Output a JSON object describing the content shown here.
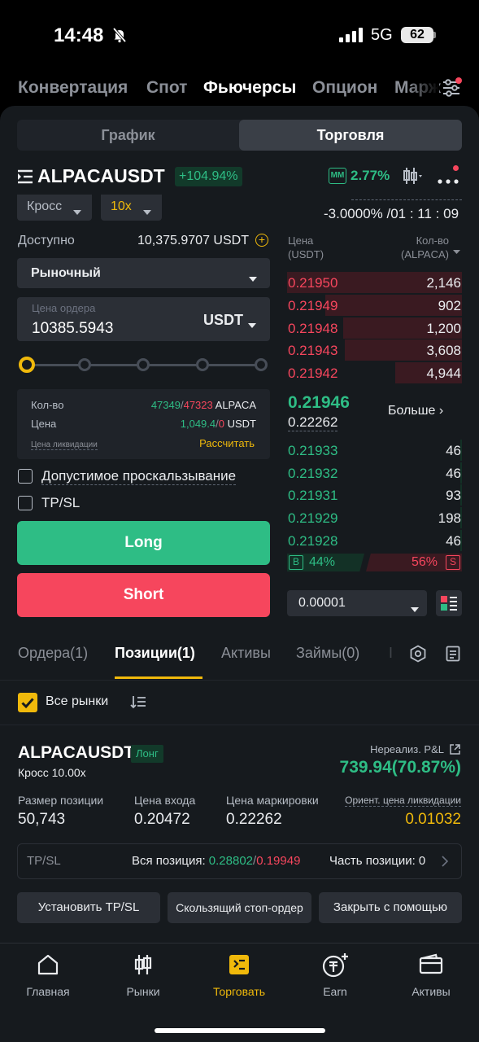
{
  "status_bar": {
    "time": "14:48",
    "network": "5G",
    "battery": "62"
  },
  "top_tabs": [
    "Конвертация",
    "Спот",
    "Фьючерсы",
    "Опцион",
    "Марж"
  ],
  "segments": {
    "chart": "График",
    "trade": "Торговля"
  },
  "pair": {
    "name": "ALPACAUSDT",
    "change": "+104.94%",
    "mm_badge": "MM",
    "mm_value": "2.77%"
  },
  "margin": {
    "mode": "Кросс",
    "leverage": "10x"
  },
  "funding": {
    "rate_countdown": "-3.0000% /01 : 11 : 09"
  },
  "order_form": {
    "available_label": "Доступно",
    "available_value": "10,375.9707 USDT",
    "order_type": "Рыночный",
    "price_placeholder": "Цена ордера",
    "price_value": "10385.5943",
    "price_unit": "USDT",
    "slider_percent": 0,
    "info": {
      "qty_label": "Кол-во",
      "qty_long": "47349",
      "qty_sep": "/",
      "qty_short": "47323",
      "qty_unit": "ALPACA",
      "price_label": "Цена",
      "price_long": "1,049.4",
      "price_short": "0",
      "price_unit": "USDT",
      "liq_label": "Цена ликвидации",
      "liq_action": "Рассчитать"
    },
    "slippage_label": "Допустимое проскальзывание",
    "tpsl_label": "TP/SL",
    "long_label": "Long",
    "short_label": "Short"
  },
  "order_book": {
    "price_head_1": "Цена",
    "price_head_2": "(USDT)",
    "qty_head_1": "Кол-во",
    "qty_head_2": "(ALPACA)",
    "asks": [
      {
        "price": "0.21950",
        "qty": "2,146",
        "depth": 1.0
      },
      {
        "price": "0.21949",
        "qty": "902",
        "depth": 0.78
      },
      {
        "price": "0.21948",
        "qty": "1,200",
        "depth": 0.68
      },
      {
        "price": "0.21943",
        "qty": "3,608",
        "depth": 0.67
      },
      {
        "price": "0.21942",
        "qty": "4,944",
        "depth": 0.38
      }
    ],
    "last_price": "0.21946",
    "mark_price": "0.22262",
    "more_label": "Больше ›",
    "bids": [
      {
        "price": "0.21933",
        "qty": "46",
        "depth": 0.01
      },
      {
        "price": "0.21932",
        "qty": "46",
        "depth": 0.01
      },
      {
        "price": "0.21931",
        "qty": "93",
        "depth": 0.01
      },
      {
        "price": "0.21929",
        "qty": "198",
        "depth": 0.01
      },
      {
        "price": "0.21928",
        "qty": "46",
        "depth": 0.01
      }
    ],
    "buy_badge": "B",
    "buy_ratio": "44%",
    "sell_ratio": "56%",
    "sell_badge": "S",
    "precision": "0.00001"
  },
  "sub_tabs": [
    "Ордера(1)",
    "Позиции(1)",
    "Активы",
    "Займы(0)",
    "I"
  ],
  "filter": {
    "all_markets": "Все рынки"
  },
  "position": {
    "symbol": "ALPACAUSDT",
    "side": "Лонг",
    "margin": "Кросс 10.00x",
    "pnl_label": "Нереализ. P&L",
    "pnl_value": "739.94(70.87%)",
    "size_label": "Размер позиции",
    "size_value": "50,743",
    "entry_label": "Цена входа",
    "entry_value": "0.20472",
    "mark_label": "Цена маркировки",
    "mark_value": "0.22262",
    "liq_label": "Ориент. цена ликвидации",
    "liq_value": "0.01032",
    "tpsl_label": "TP/SL",
    "tpsl_all_label": "Вся позиция: ",
    "tpsl_tp": "0.28802",
    "tpsl_sep": "/",
    "tpsl_sl": "0.19949",
    "tpsl_part": "Часть позиции: 0",
    "btn_set_tpsl": "Установить TP/SL",
    "btn_trailing": "Скользящий стоп-ордер",
    "btn_close": "Закрыть с помощью"
  },
  "bottom_nav": [
    "Главная",
    "Рынки",
    "Торговать",
    "Earn",
    "Активы"
  ],
  "colors": {
    "green": "#2ebd85",
    "red": "#f6465d",
    "accent": "#f0b90b",
    "panel": "#161a1e"
  }
}
